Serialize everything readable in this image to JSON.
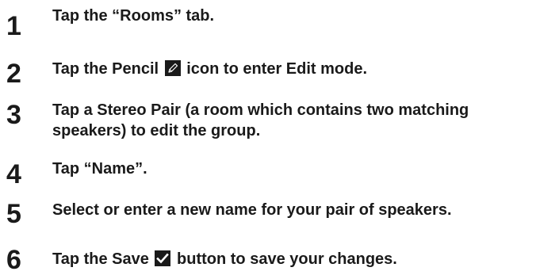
{
  "steps": [
    {
      "number": "1",
      "text": "Tap the “Rooms” tab."
    },
    {
      "number": "2",
      "before": "Tap the Pencil",
      "icon": "pencil-icon",
      "after": "icon to enter Edit mode."
    },
    {
      "number": "3",
      "line1": "Tap a Stereo Pair (a room which contains two matching",
      "line2": "speakers) to edit the group."
    },
    {
      "number": "4",
      "text": "Tap “Name”."
    },
    {
      "number": "5",
      "text": "Select or enter a new name for your pair of speakers."
    },
    {
      "number": "6",
      "before": "Tap the Save",
      "icon": "checkmark-icon",
      "after": "button to save your changes."
    }
  ]
}
